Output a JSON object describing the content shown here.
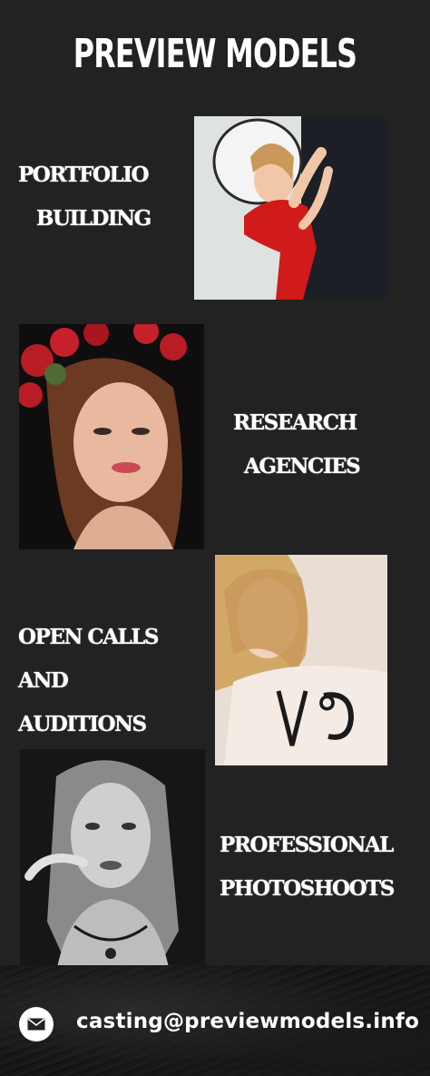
{
  "header": {
    "title": "PREVIEW MODELS"
  },
  "sections": [
    {
      "label_line1": "PORTFOLIO",
      "label_line2": "BUILDING",
      "photo": "model in red dress with white hat"
    },
    {
      "label_line1": "RESEARCH",
      "label_line2": "AGENCIES",
      "photo": "model with red flower crown"
    },
    {
      "label_line1": "OPEN CALLS",
      "label_line2": "AND",
      "label_line3": "AUDITIONS",
      "photo": "blonde model in white sweater"
    },
    {
      "label_line1": "PROFESSIONAL",
      "label_line2": "PHOTOSHOOTS",
      "photo": "black and white portrait of model"
    }
  ],
  "footer": {
    "icon": "mail-icon",
    "email": "casting@previewmodels.info"
  },
  "colors": {
    "background": "#222222",
    "text": "#ffffff"
  }
}
